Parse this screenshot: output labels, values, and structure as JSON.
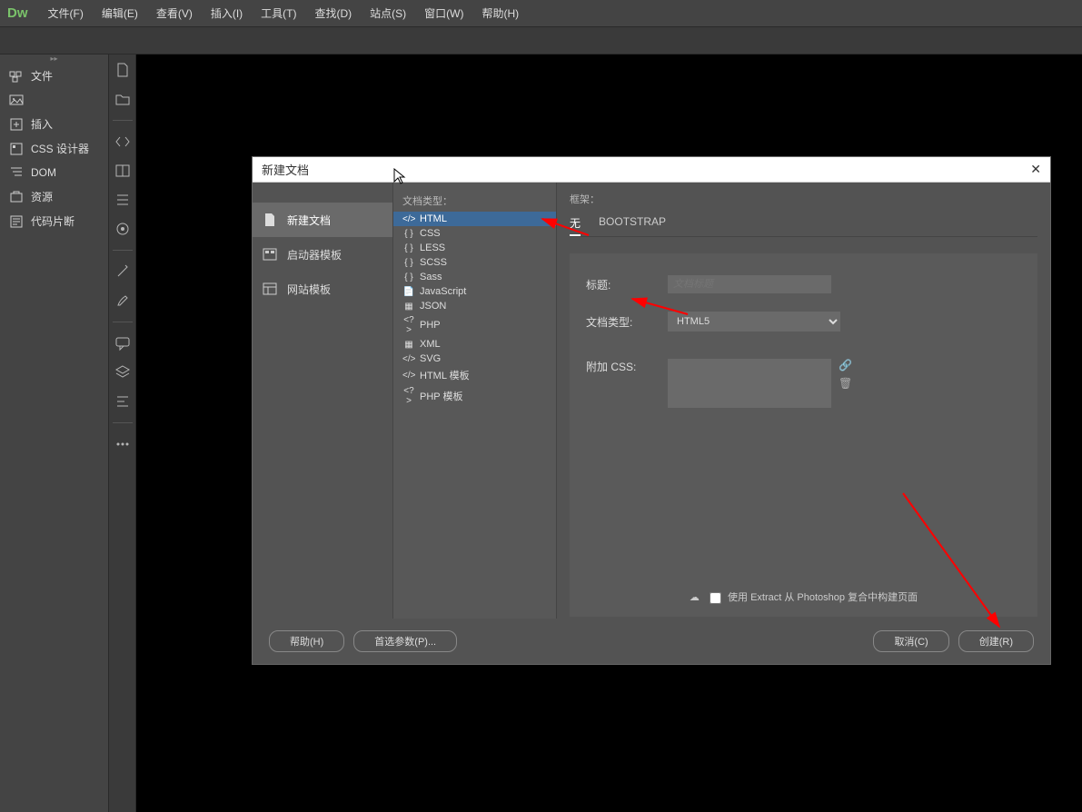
{
  "app": {
    "logo": "Dw"
  },
  "menu": [
    "文件(F)",
    "编辑(E)",
    "查看(V)",
    "插入(I)",
    "工具(T)",
    "查找(D)",
    "站点(S)",
    "窗口(W)",
    "帮助(H)"
  ],
  "sidebar": {
    "items": [
      {
        "label": "文件",
        "icon": "files-icon"
      },
      {
        "label": "插入",
        "icon": "insert-icon"
      },
      {
        "label": "CSS 设计器",
        "icon": "css-designer-icon"
      },
      {
        "label": "DOM",
        "icon": "dom-icon"
      },
      {
        "label": "资源",
        "icon": "assets-icon"
      },
      {
        "label": "代码片断",
        "icon": "snippets-icon"
      }
    ]
  },
  "dialog": {
    "title": "新建文档",
    "left": [
      {
        "label": "新建文档",
        "selected": true
      },
      {
        "label": "启动器模板",
        "selected": false
      },
      {
        "label": "网站模板",
        "selected": false
      }
    ],
    "mid_label": "文档类型：",
    "doc_types": [
      {
        "label": "HTML",
        "selected": true
      },
      {
        "label": "CSS"
      },
      {
        "label": "LESS"
      },
      {
        "label": "SCSS"
      },
      {
        "label": "Sass"
      },
      {
        "label": "JavaScript"
      },
      {
        "label": "JSON"
      },
      {
        "label": "PHP"
      },
      {
        "label": "XML"
      },
      {
        "label": "SVG"
      },
      {
        "label": "HTML 模板"
      },
      {
        "label": "PHP 模板"
      }
    ],
    "right": {
      "framework_label": "框架：",
      "tabs": [
        {
          "label": "无",
          "active": true
        },
        {
          "label": "BOOTSTRAP",
          "active": false
        }
      ],
      "title_label": "标题:",
      "title_placeholder": "文档标题",
      "doctype_label": "文档类型:",
      "doctype_value": "HTML5",
      "css_label": "附加 CSS:",
      "extract_label": "使用 Extract 从 Photoshop 复合中构建页面"
    },
    "footer": {
      "help": "帮助(H)",
      "prefs": "首选参数(P)...",
      "cancel": "取消(C)",
      "create": "创建(R)"
    }
  }
}
